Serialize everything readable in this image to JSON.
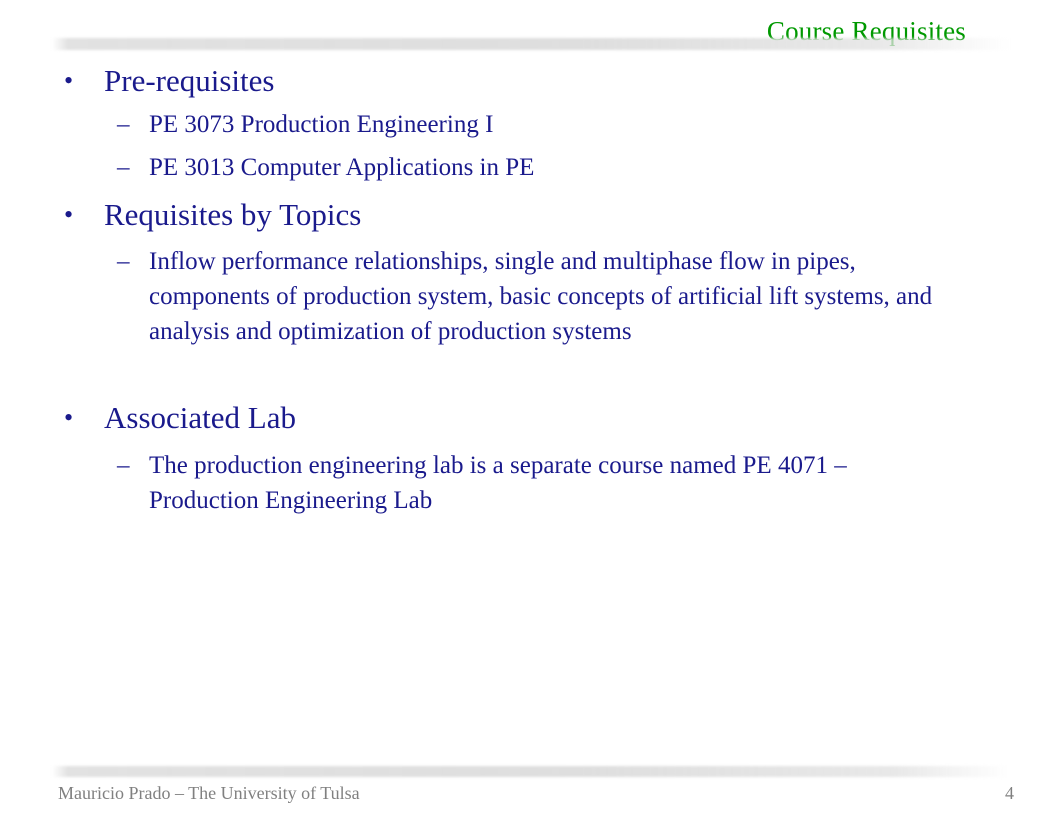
{
  "header": {
    "title": "Course Requisites",
    "title_color": "#009900",
    "divider": "header-divider-bar"
  },
  "theme": {
    "background": "#ffffff",
    "body_text_color": "#1a1a8c",
    "accent_color": "#009900",
    "footer_text_color": "#808080",
    "divider_color": "#e0e0e0"
  },
  "content": {
    "bullets": [
      {
        "marker": "•",
        "text": "Pre-requisites",
        "sub": [
          {
            "marker": "–",
            "text": "PE 3073 Production Engineering I"
          },
          {
            "marker": "–",
            "text": "PE 3013 Computer Applications in PE"
          }
        ]
      },
      {
        "marker": "•",
        "text": "Requisites by Topics",
        "sub": [
          {
            "marker": "–",
            "text": "Inflow performance relationships, single and multiphase flow in pipes, components of production system, basic concepts of artificial lift systems, and analysis and optimization of production systems"
          }
        ]
      },
      {
        "marker": "•",
        "text": "Associated Lab",
        "sub": [
          {
            "marker": "–",
            "text": "The production engineering lab is a separate course named PE 4071 – Production Engineering Lab"
          }
        ]
      }
    ]
  },
  "footer": {
    "note": "Mauricio Prado – The University of Tulsa",
    "page_number": "4"
  }
}
